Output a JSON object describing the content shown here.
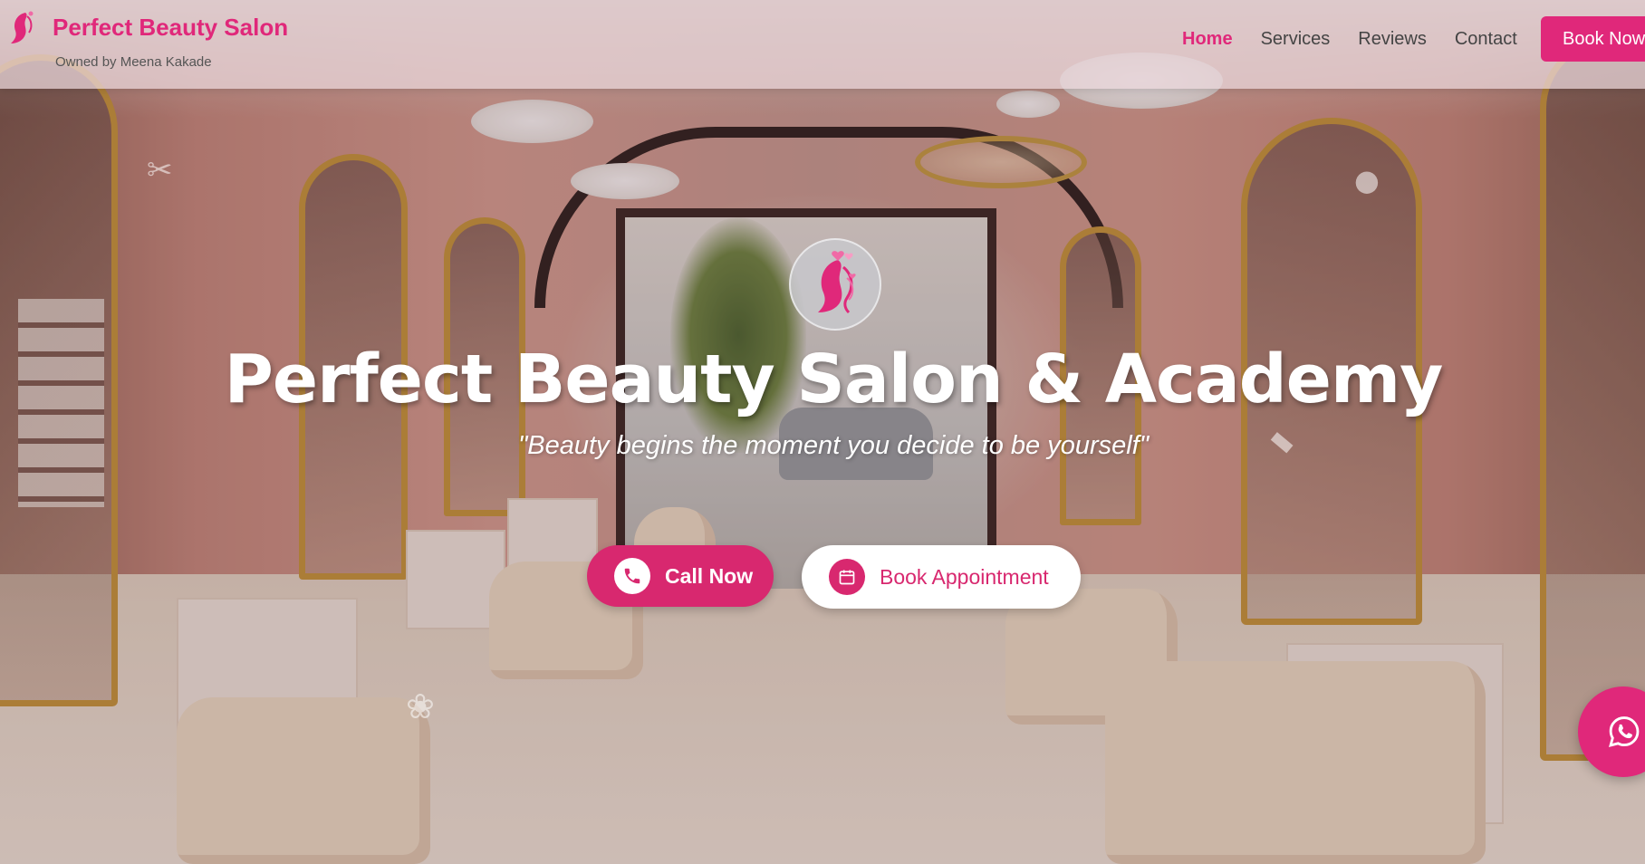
{
  "brand": {
    "name": "Perfect Beauty Salon",
    "owner": "Owned by Meena Kakade",
    "logo_icon": "woman-silhouette-icon"
  },
  "nav": {
    "items": [
      {
        "label": "Home",
        "active": true
      },
      {
        "label": "Services",
        "active": false
      },
      {
        "label": "Reviews",
        "active": false
      },
      {
        "label": "Contact",
        "active": false
      }
    ],
    "book_now_label": "Book Now"
  },
  "hero": {
    "logo_icon": "woman-silhouette-hearts-icon",
    "title": "Perfect Beauty Salon & Academy",
    "tagline": "\"Beauty begins the moment you decide to be yourself\"",
    "call_button": {
      "label": "Call Now",
      "icon": "phone-icon"
    },
    "book_button": {
      "label": "Book Appointment",
      "icon": "calendar-icon"
    },
    "decor_icons": [
      "scissors-icon",
      "lotus-icon",
      "brush-icon",
      "pin-icon"
    ]
  },
  "floating": {
    "whatsapp_icon": "whatsapp-icon"
  },
  "colors": {
    "accent": "#e0287a",
    "nav_background": "#ecd8dc",
    "text_dark": "#444444",
    "white": "#ffffff"
  }
}
